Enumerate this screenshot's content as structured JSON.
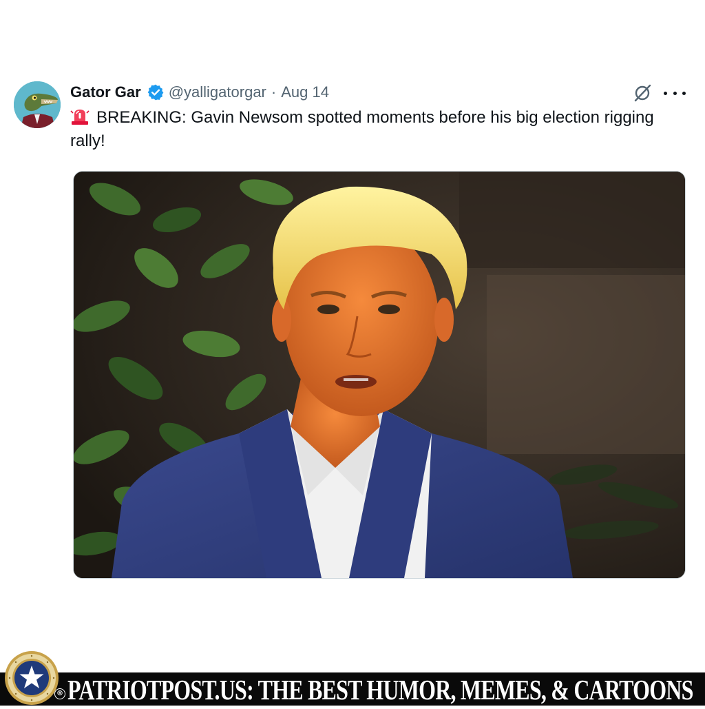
{
  "tweet": {
    "display_name": "Gator Gar",
    "handle": "@yalligatorgar",
    "separator": "·",
    "date": "Aug 14",
    "text": "BREAKING: Gavin Newsom spotted moments before his big election rigging rally!",
    "icons": {
      "avatar": "alligator-avatar",
      "verified": "verified-badge-icon",
      "alert_emoji": "rotating-light-icon",
      "grok": "grok-icon",
      "more": "more-options-icon"
    },
    "colors": {
      "text": "#0f1419",
      "secondary": "#536471",
      "verified": "#1d9bf0"
    }
  },
  "footer": {
    "banner": "PATRIOTPOST.US: THE BEST HUMOR, MEMES, & CARTOONS",
    "registered_mark": "®",
    "background": "#0a0a0a"
  }
}
